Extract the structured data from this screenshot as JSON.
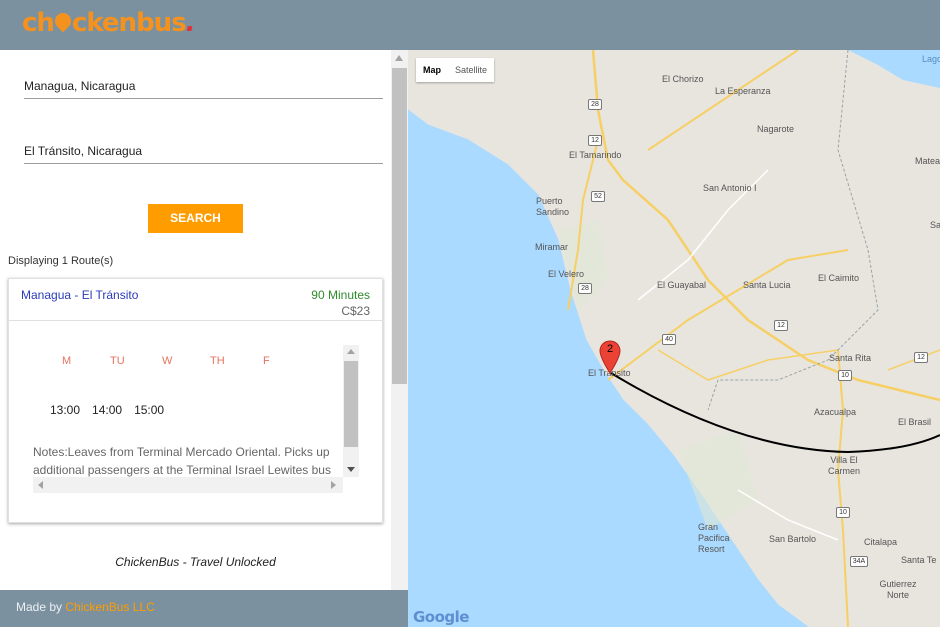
{
  "app": {
    "logo_part1": "ch",
    "logo_part2": "ckenbus",
    "logo_suffix": "."
  },
  "search": {
    "origin_value": "Managua, Nicaragua",
    "destination_value": "El Tránsito, Nicaragua",
    "button_label": "SEARCH"
  },
  "results": {
    "count_text": "Displaying 1 Route(s)",
    "routes": [
      {
        "name": "Managua - El Tránsito",
        "duration": "90 Minutes",
        "price": "C$23",
        "days": [
          "M",
          "TU",
          "W",
          "TH",
          "F"
        ],
        "times": [
          "13:00",
          "14:00",
          "15:00"
        ],
        "notes": "Notes:Leaves from Terminal Mercado Oriental. Picks up additional passengers at the Terminal Israel Lewites bus"
      }
    ]
  },
  "tagline": "ChickenBus - Travel Unlocked",
  "footer": {
    "made_by": "Made by",
    "company": "ChickenBus LLC"
  },
  "map": {
    "type_map": "Map",
    "type_satellite": "Satellite",
    "marker_label": "2",
    "attribution": "Google",
    "places": [
      "El Chorizo",
      "La Esperanza",
      "Nagarote",
      "El Tamarindo",
      "San Antonio I",
      "Puerto Sandino",
      "Miramar",
      "El Velero",
      "El Guayabal",
      "Santa Lucia",
      "El Caimito",
      "Santa Rita",
      "El Tránsito",
      "Azacualpa",
      "El Brasil",
      "Villa El Carmen",
      "Gran Pacifica Resort",
      "San Bartolo",
      "Citalapa",
      "Santa Te",
      "Gutierrez Norte",
      "Matea",
      "Lago",
      "Santa de"
    ],
    "road_numbers": [
      "28",
      "12",
      "52",
      "28",
      "12",
      "40",
      "12",
      "10",
      "10",
      "34A"
    ]
  },
  "colors": {
    "accent": "#ff9d00",
    "header": "#7b919f",
    "route_link": "#2b3cb8",
    "duration": "#2e8b2e",
    "day": "#e5735d",
    "water": "#aadaff",
    "land": "#e8e5df"
  }
}
